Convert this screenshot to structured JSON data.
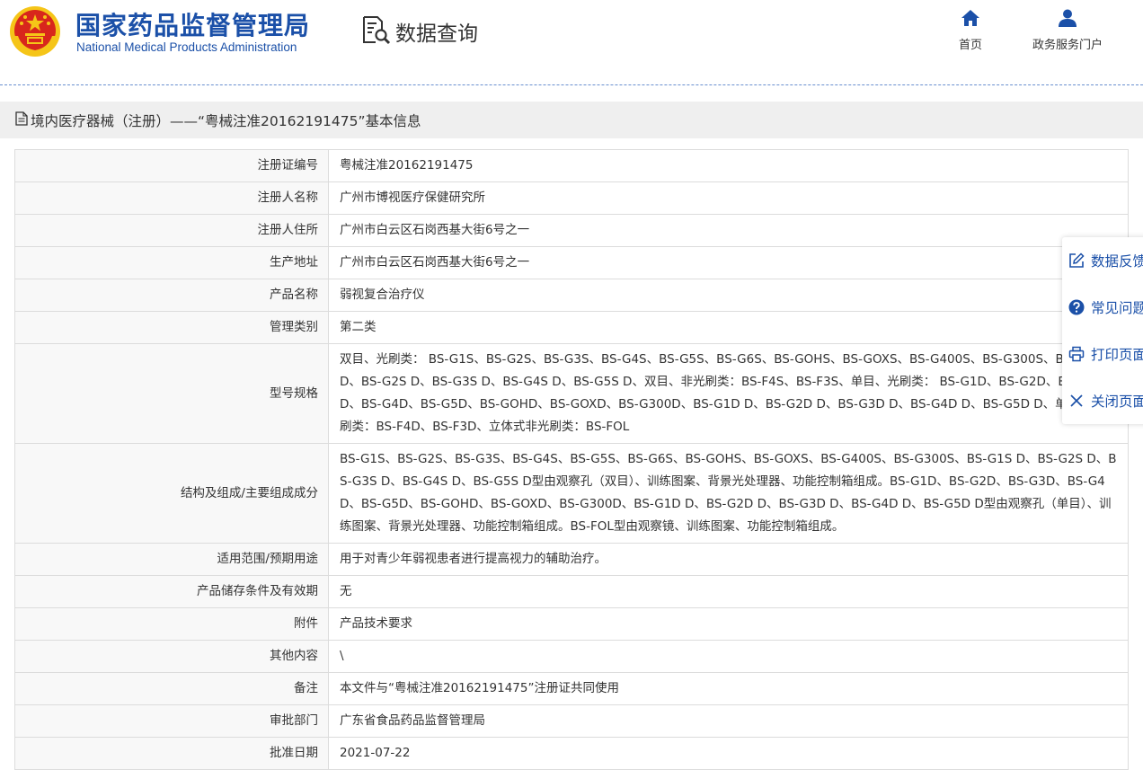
{
  "header": {
    "logo_cn": "国家药品监督管理局",
    "logo_en": "National Medical Products Administration",
    "query_title": "数据查询",
    "nav": [
      {
        "label": "首页",
        "icon": "home-icon"
      },
      {
        "label": "政务服务门户",
        "icon": "user-icon"
      }
    ]
  },
  "title_bar": {
    "icon": "document-icon",
    "text": "境内医疗器械（注册）——“粤械注准20162191475”基本信息"
  },
  "rows": [
    {
      "label": "注册证编号",
      "value": "粤械注准20162191475"
    },
    {
      "label": "注册人名称",
      "value": "广州市博视医疗保健研究所"
    },
    {
      "label": "注册人住所",
      "value": "广州市白云区石岗西基大街6号之一"
    },
    {
      "label": "生产地址",
      "value": "广州市白云区石岗西基大街6号之一"
    },
    {
      "label": "产品名称",
      "value": "弱视复合治疗仪"
    },
    {
      "label": "管理类别",
      "value": "第二类"
    },
    {
      "label": "型号规格",
      "value": "双目、光刷类： BS-G1S、BS-G2S、BS-G3S、BS-G4S、BS-G5S、BS-G6S、BS-GOHS、BS-GOXS、BS-G400S、BS-G300S、BS-G1S D、BS-G2S D、BS-G3S D、BS-G4S D、BS-G5S D、双目、非光刷类：BS-F4S、BS-F3S、单目、光刷类： BS-G1D、BS-G2D、BS-G3D、BS-G4D、BS-G5D、BS-GOHD、BS-GOXD、BS-G300D、BS-G1D D、BS-G2D D、BS-G3D D、BS-G4D D、BS-G5D D、单目、非光刷类：BS-F4D、BS-F3D、立体式非光刷类：BS-FOL"
    },
    {
      "label": "结构及组成/主要组成成分",
      "value": "BS-G1S、BS-G2S、BS-G3S、BS-G4S、BS-G5S、BS-G6S、BS-GOHS、BS-GOXS、BS-G400S、BS-G300S、BS-G1S D、BS-G2S D、BS-G3S D、BS-G4S D、BS-G5S D型由观察孔（双目）、训练图案、背景光处理器、功能控制箱组成。BS-G1D、BS-G2D、BS-G3D、BS-G4D、BS-G5D、BS-GOHD、BS-GOXD、BS-G300D、BS-G1D D、BS-G2D D、BS-G3D D、BS-G4D D、BS-G5D D型由观察孔（单目）、训练图案、背景光处理器、功能控制箱组成。BS-FOL型由观察镜、训练图案、功能控制箱组成。"
    },
    {
      "label": "适用范围/预期用途",
      "value": "用于对青少年弱视患者进行提高视力的辅助治疗。"
    },
    {
      "label": "产品储存条件及有效期",
      "value": "无"
    },
    {
      "label": "附件",
      "value": "产品技术要求"
    },
    {
      "label": "其他内容",
      "value": "\\"
    },
    {
      "label": "备注",
      "value": "本文件与“粤械注准20162191475”注册证共同使用"
    },
    {
      "label": "审批部门",
      "value": "广东省食品药品监督管理局"
    },
    {
      "label": "批准日期",
      "value": "2021-07-22"
    }
  ],
  "side_panel": [
    {
      "label": "数据反馈",
      "icon": "edit-icon"
    },
    {
      "label": "常见问题",
      "icon": "question-icon"
    },
    {
      "label": "打印页面",
      "icon": "print-icon"
    },
    {
      "label": "关闭页面",
      "icon": "close-icon"
    }
  ],
  "colors": {
    "brand": "#1b50a8",
    "emblem_red": "#d8261c",
    "emblem_gold": "#f5c518",
    "label_bg": "#f8f8f8"
  }
}
